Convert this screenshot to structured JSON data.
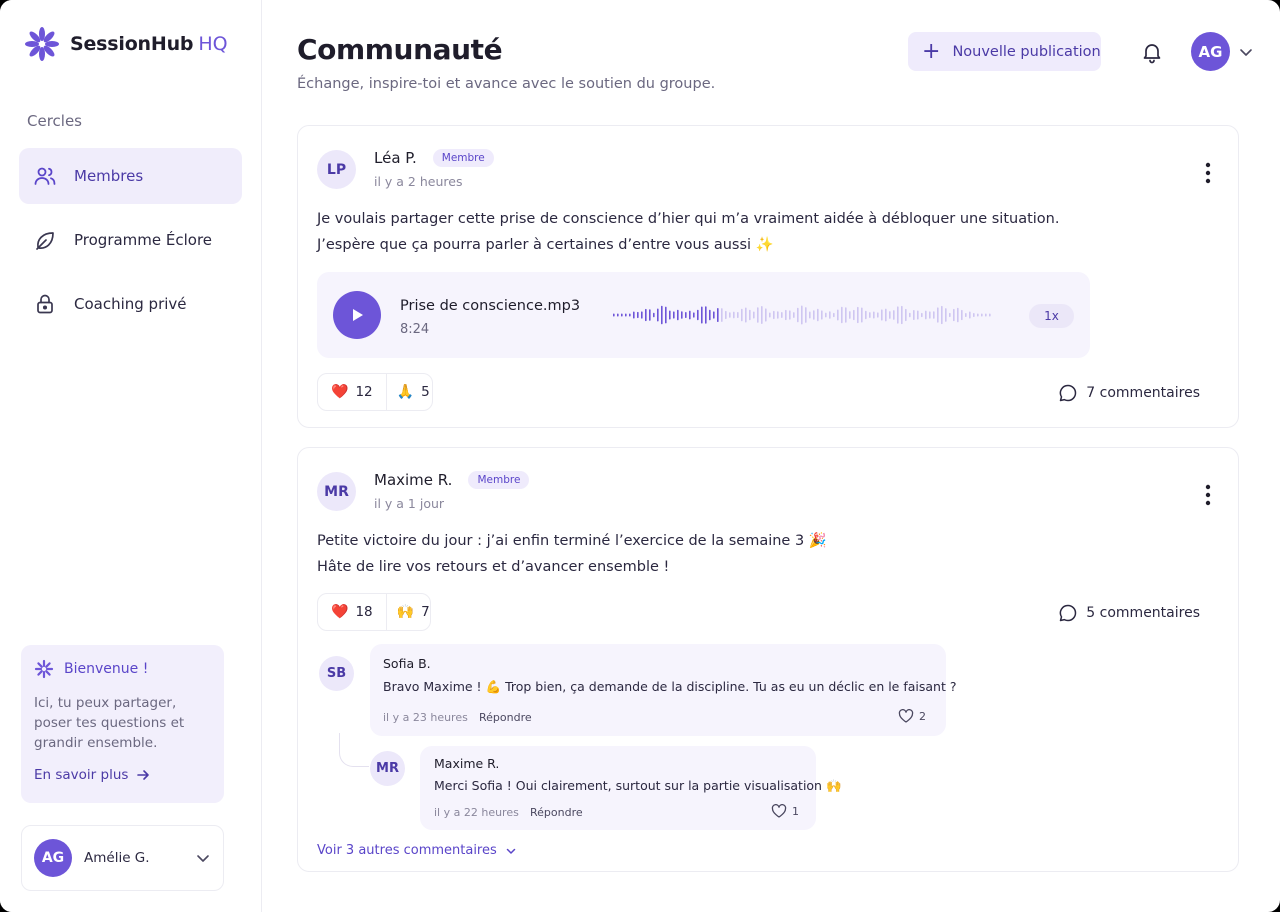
{
  "brand": {
    "name": "SessionHub",
    "suffix": "HQ"
  },
  "sidebar": {
    "section_title": "Cercles",
    "items": [
      {
        "label": "Membres",
        "icon": "users-icon",
        "active": true
      },
      {
        "label": "Programme Éclore",
        "icon": "leaf-icon",
        "active": false
      },
      {
        "label": "Coaching privé",
        "icon": "lock-icon",
        "active": false
      }
    ],
    "welcome": {
      "title": "Bienvenue !",
      "text": "Ici, tu peux partager, poser tes questions et grandir ensemble.",
      "link": "En savoir plus"
    },
    "user": {
      "initials": "AG",
      "name": "Amélie G."
    }
  },
  "header": {
    "title": "Communauté",
    "subtitle": "Échange, inspire-toi et avance avec le soutien du groupe.",
    "new_post_label": "Nouvelle publication",
    "avatar_initials": "AG"
  },
  "posts": [
    {
      "initials": "LP",
      "author": "Léa P.",
      "badge": "Membre",
      "time": "il y a 2 heures",
      "lines": [
        "Je voulais partager cette prise de conscience d’hier qui m’a vraiment aidée à débloquer une situation.",
        "J’espère que ça pourra parler à certaines d’entre vous aussi ✨"
      ],
      "audio": {
        "name": "Prise de conscience.mp3",
        "duration": "8:24",
        "speed": "1x",
        "progress": 0.28
      },
      "reactions": [
        {
          "emoji": "❤️",
          "count": "12"
        },
        {
          "emoji": "🙏",
          "count": "5"
        }
      ],
      "comments_label": "7 commentaires"
    },
    {
      "initials": "MR",
      "author": "Maxime R.",
      "badge": "Membre",
      "time": "il y a 1 jour",
      "lines": [
        "Petite victoire du jour : j’ai enfin terminé l’exercice de la semaine 3 🎉",
        "Hâte de lire vos retours et d’avancer ensemble !"
      ],
      "reactions": [
        {
          "emoji": "❤️",
          "count": "18"
        },
        {
          "emoji": "🙌",
          "count": "7"
        }
      ],
      "comments_label": "5 commentaires",
      "comments": [
        {
          "initials": "SB",
          "author": "Sofia B.",
          "text": "Bravo Maxime ! 💪 Trop bien, ça demande de la discipline. Tu as eu un déclic en le faisant ?",
          "time": "il y a 23 heures",
          "reply": "Répondre",
          "likes": "2"
        },
        {
          "initials": "MR",
          "author": "Maxime R.",
          "text": "Merci Sofia ! Oui clairement, surtout sur la partie visualisation 🙌",
          "time": "il y a 22 heures",
          "reply": "Répondre",
          "likes": "1"
        }
      ],
      "more_comments": "Voir 3 autres commentaires"
    }
  ],
  "colors": {
    "accent": "#6d55d8",
    "accent_soft": "#efebfc",
    "text": "#1f1d2b",
    "muted": "#6b6880"
  }
}
